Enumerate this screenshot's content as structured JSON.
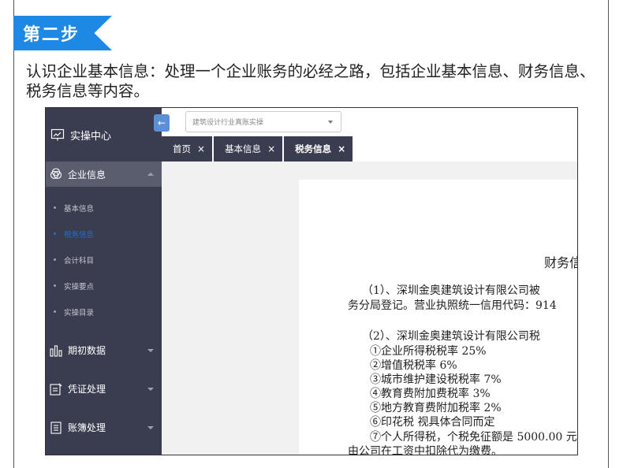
{
  "step": {
    "label": "第二步"
  },
  "intro": "认识企业基本信息：处理一个企业账务的必经之路，包括企业基本信息、财务信息、税务信息等内容。",
  "sidebar": {
    "brand": "实操中心",
    "group": "企业信息",
    "subitems": [
      "基本信息",
      "税务信息",
      "会计科目",
      "实操要点",
      "实操目录"
    ],
    "items": [
      "期初数据",
      "凭证处理",
      "账簿处理"
    ]
  },
  "topbar": {
    "collapse_icon": "←",
    "select_value": "建筑设计行业真账实操"
  },
  "tabs": [
    {
      "label": "首页",
      "close": "×"
    },
    {
      "label": "基本信息",
      "close": "×"
    },
    {
      "label": "税务信息",
      "close": "×"
    }
  ],
  "document": {
    "title": "财务信",
    "lines": [
      "（1）、深圳金奥建筑设计有限公司被",
      "务分局登记。营业执照统一信用代码：914",
      "（2）、深圳金奥建筑设计有限公司税",
      "①企业所得税税率        25%",
      "②增值税税率              6%",
      "③城市维护建设税税率     7%",
      "④教育费附加费税率       3%",
      "⑤地方教育费附加税率     2%",
      "⑥印花税            视具体合同而定",
      "⑦个人所得税，个税免征额是 5000.00 元,",
      "由公司在工资中扣除代为缴费。"
    ]
  }
}
